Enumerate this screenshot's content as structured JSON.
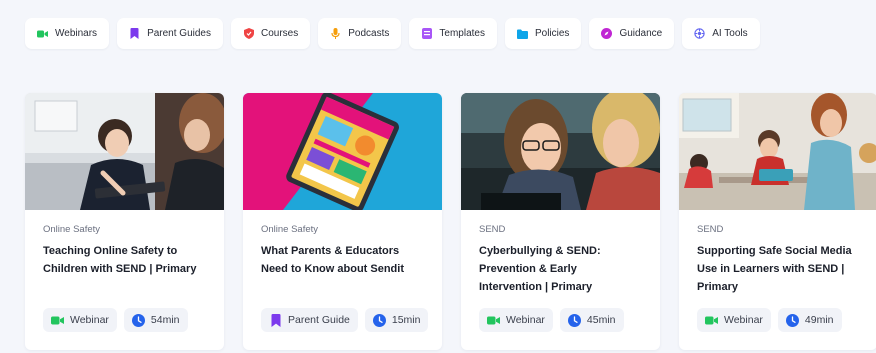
{
  "filters": [
    {
      "label": "Webinars",
      "icon": "video-camera-icon",
      "color": "#22c55e"
    },
    {
      "label": "Parent Guides",
      "icon": "bookmark-icon",
      "color": "#7c3aed"
    },
    {
      "label": "Courses",
      "icon": "shield-icon",
      "color": "#ef4444"
    },
    {
      "label": "Podcasts",
      "icon": "microphone-icon",
      "color": "#f59e0b"
    },
    {
      "label": "Templates",
      "icon": "template-icon",
      "color": "#a855f7"
    },
    {
      "label": "Policies",
      "icon": "folder-icon",
      "color": "#0ea5e9"
    },
    {
      "label": "Guidance",
      "icon": "compass-icon",
      "color": "#c026d3"
    },
    {
      "label": "AI Tools",
      "icon": "ai-chip-icon",
      "color": "#6366f1"
    }
  ],
  "cards": [
    {
      "category": "Online Safety",
      "title": "Teaching Online Safety to Children with SEND | Primary",
      "type_label": "Webinar",
      "type_icon": "video-camera-icon",
      "duration": "54min",
      "image": "child-using-tablet-with-teacher"
    },
    {
      "category": "Online Safety",
      "title": "What Parents & Educators Need to Know about Sendit",
      "type_label": "Parent Guide",
      "type_icon": "bookmark-icon",
      "duration": "15min",
      "image": "tablet-guide-cover-on-pink-blue"
    },
    {
      "category": "SEND",
      "title": "Cyberbullying & SEND: Prevention & Early Intervention | Primary",
      "type_label": "Webinar",
      "type_icon": "video-camera-icon",
      "duration": "45min",
      "image": "two-people-looking-at-screen"
    },
    {
      "category": "SEND",
      "title": "Supporting Safe Social Media Use in Learners with SEND | Primary",
      "type_label": "Webinar",
      "type_icon": "video-camera-icon",
      "duration": "49min",
      "image": "classroom-with-students-and-teacher"
    }
  ],
  "colors": {
    "webinar_green": "#22c55e",
    "guide_purple": "#7c3aed",
    "clock_blue": "#2563eb"
  }
}
